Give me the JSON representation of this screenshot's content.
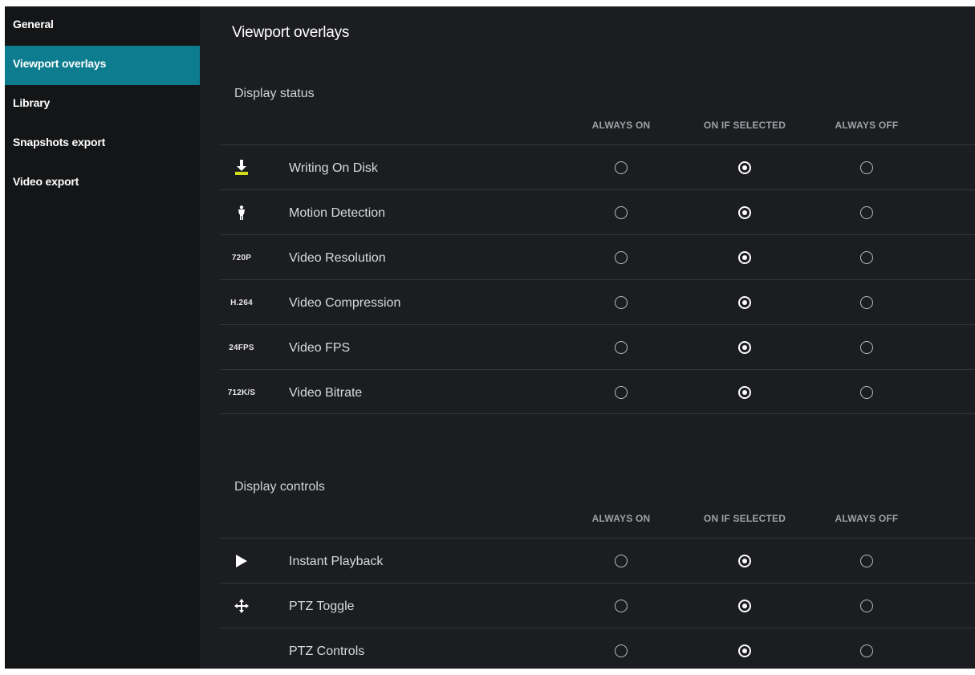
{
  "sidebar": {
    "items": [
      {
        "label": "General"
      },
      {
        "label": "Viewport overlays"
      },
      {
        "label": "Library"
      },
      {
        "label": "Snapshots export"
      },
      {
        "label": "Video export"
      }
    ],
    "active_index": 1
  },
  "page": {
    "title": "Viewport overlays"
  },
  "columns": [
    "ALWAYS ON",
    "ON IF SELECTED",
    "ALWAYS OFF"
  ],
  "display_status": {
    "title": "Display status",
    "rows": [
      {
        "icon": "download-disk-icon",
        "icon_text": "",
        "label": "Writing On Disk",
        "selected": "ON IF SELECTED"
      },
      {
        "icon": "motion-person-icon",
        "icon_text": "",
        "label": "Motion Detection",
        "selected": "ON IF SELECTED"
      },
      {
        "icon": "resolution-icon",
        "icon_text": "720P",
        "label": "Video Resolution",
        "selected": "ON IF SELECTED"
      },
      {
        "icon": "compression-icon",
        "icon_text": "H.264",
        "label": "Video Compression",
        "selected": "ON IF SELECTED"
      },
      {
        "icon": "fps-icon",
        "icon_text": "24FPS",
        "label": "Video FPS",
        "selected": "ON IF SELECTED"
      },
      {
        "icon": "bitrate-icon",
        "icon_text": "712K/S",
        "label": "Video Bitrate",
        "selected": "ON IF SELECTED"
      }
    ]
  },
  "display_controls": {
    "title": "Display controls",
    "rows": [
      {
        "icon": "play-icon",
        "icon_text": "",
        "label": "Instant Playback",
        "selected": "ON IF SELECTED"
      },
      {
        "icon": "move-arrows-icon",
        "icon_text": "",
        "label": "PTZ Toggle",
        "selected": "ON IF SELECTED"
      },
      {
        "icon": "",
        "icon_text": "",
        "label": "PTZ Controls",
        "selected": "ON IF SELECTED"
      }
    ]
  },
  "colors": {
    "accent": "#0d7c8f",
    "icon_yellow": "#d4dd1a"
  }
}
